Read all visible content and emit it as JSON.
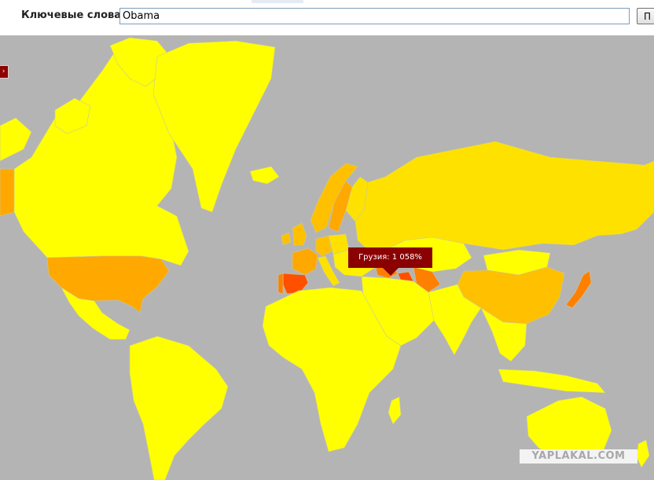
{
  "search": {
    "label": "Ключевые слова:",
    "value": "Obama",
    "button_label": "П"
  },
  "map": {
    "tooltip": "Грузия: 1 058%",
    "watermark": "YAPLAKAL.COM",
    "colors": {
      "ocean": "#b4b4b4",
      "border": "#c8c8a0",
      "yellow": "#ffff00",
      "light_yellow": "#ffef00",
      "gold": "#ffe100",
      "amber": "#ffc000",
      "orange": "#ffa800",
      "dark_orange": "#ff7f00",
      "red_orange": "#ff5000",
      "tooltip_bg": "#8b0000"
    },
    "countries": {
      "canada": "yellow",
      "alaska": "yellow",
      "greenland": "yellow",
      "usa": "orange",
      "mexico": "yellow",
      "south_america": "yellow",
      "iceland": "yellow",
      "uk": "amber",
      "ireland": "amber",
      "norway": "amber",
      "sweden": "orange",
      "finland": "gold",
      "france": "orange",
      "spain": "red_orange",
      "portugal": "dark_orange",
      "germany": "amber",
      "italy": "gold",
      "poland": "gold",
      "russia": "gold",
      "kazakhstan": "yellow",
      "mongolia": "yellow",
      "china": "amber",
      "japan": "dark_orange",
      "africa": "yellow",
      "middle_east": "yellow",
      "india": "yellow",
      "southeast_asia": "yellow",
      "indonesia": "yellow",
      "australia": "yellow",
      "new_zealand": "yellow",
      "georgia": "dark_orange",
      "caucasus": "red_orange",
      "central_asia": "dark_orange"
    }
  }
}
